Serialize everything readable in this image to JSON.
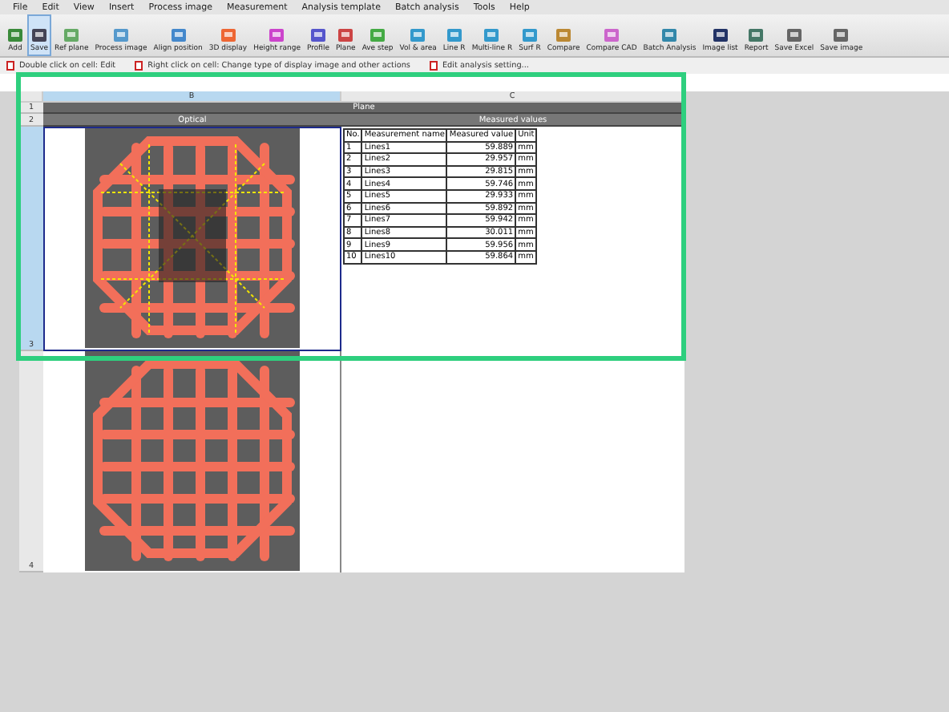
{
  "menu": [
    "File",
    "Edit",
    "View",
    "Insert",
    "Process image",
    "Measurement",
    "Analysis template",
    "Batch analysis",
    "Tools",
    "Help"
  ],
  "toolbar": [
    {
      "label": "Add",
      "selected": false
    },
    {
      "label": "Save",
      "selected": true
    },
    {
      "label": "Ref plane",
      "selected": false
    },
    {
      "label": "Process image",
      "selected": false
    },
    {
      "label": "Align position",
      "selected": false
    },
    {
      "label": "3D display",
      "selected": false
    },
    {
      "label": "Height range",
      "selected": false
    },
    {
      "label": "Profile",
      "selected": false
    },
    {
      "label": "Plane",
      "selected": false
    },
    {
      "label": "Ave step",
      "selected": false
    },
    {
      "label": "Vol & area",
      "selected": false
    },
    {
      "label": "Line R",
      "selected": false
    },
    {
      "label": "Multi-line R",
      "selected": false
    },
    {
      "label": "Surf R",
      "selected": false
    },
    {
      "label": "Compare",
      "selected": false
    },
    {
      "label": "Compare CAD",
      "selected": false
    },
    {
      "label": "Batch Analysis",
      "selected": false
    },
    {
      "label": "Image list",
      "selected": false
    },
    {
      "label": "Report",
      "selected": false
    },
    {
      "label": "Save Excel",
      "selected": false
    },
    {
      "label": "Save image",
      "selected": false
    }
  ],
  "hints": [
    "Double click on cell: Edit",
    "Right click on cell: Change type of display image and other actions",
    "Edit analysis setting..."
  ],
  "sheet": {
    "columns": [
      {
        "label": "B",
        "selected": true
      },
      {
        "label": "C",
        "selected": false
      }
    ],
    "row_numbers": [
      {
        "label": "1",
        "selected": false
      },
      {
        "label": "2",
        "selected": false
      },
      {
        "label": "3",
        "selected": true
      },
      {
        "label": "4",
        "selected": false
      }
    ],
    "title": "Plane",
    "image_header": "Optical",
    "values_header": "Measured values",
    "table": {
      "columns": [
        "No.",
        "Measurement name",
        "Measured value",
        "Unit"
      ],
      "rows": [
        [
          "1",
          "Lines1",
          "59.889",
          "mm"
        ],
        [
          "2",
          "Lines2",
          "29.957",
          "mm"
        ],
        [
          "3",
          "Lines3",
          "29.815",
          "mm"
        ],
        [
          "4",
          "Lines4",
          "59.746",
          "mm"
        ],
        [
          "5",
          "Lines5",
          "29.933",
          "mm"
        ],
        [
          "6",
          "Lines6",
          "59.892",
          "mm"
        ],
        [
          "7",
          "Lines7",
          "59.942",
          "mm"
        ],
        [
          "8",
          "Lines8",
          "30.011",
          "mm"
        ],
        [
          "9",
          "Lines9",
          "59.956",
          "mm"
        ],
        [
          "10",
          "Lines10",
          "59.864",
          "mm"
        ]
      ]
    }
  }
}
